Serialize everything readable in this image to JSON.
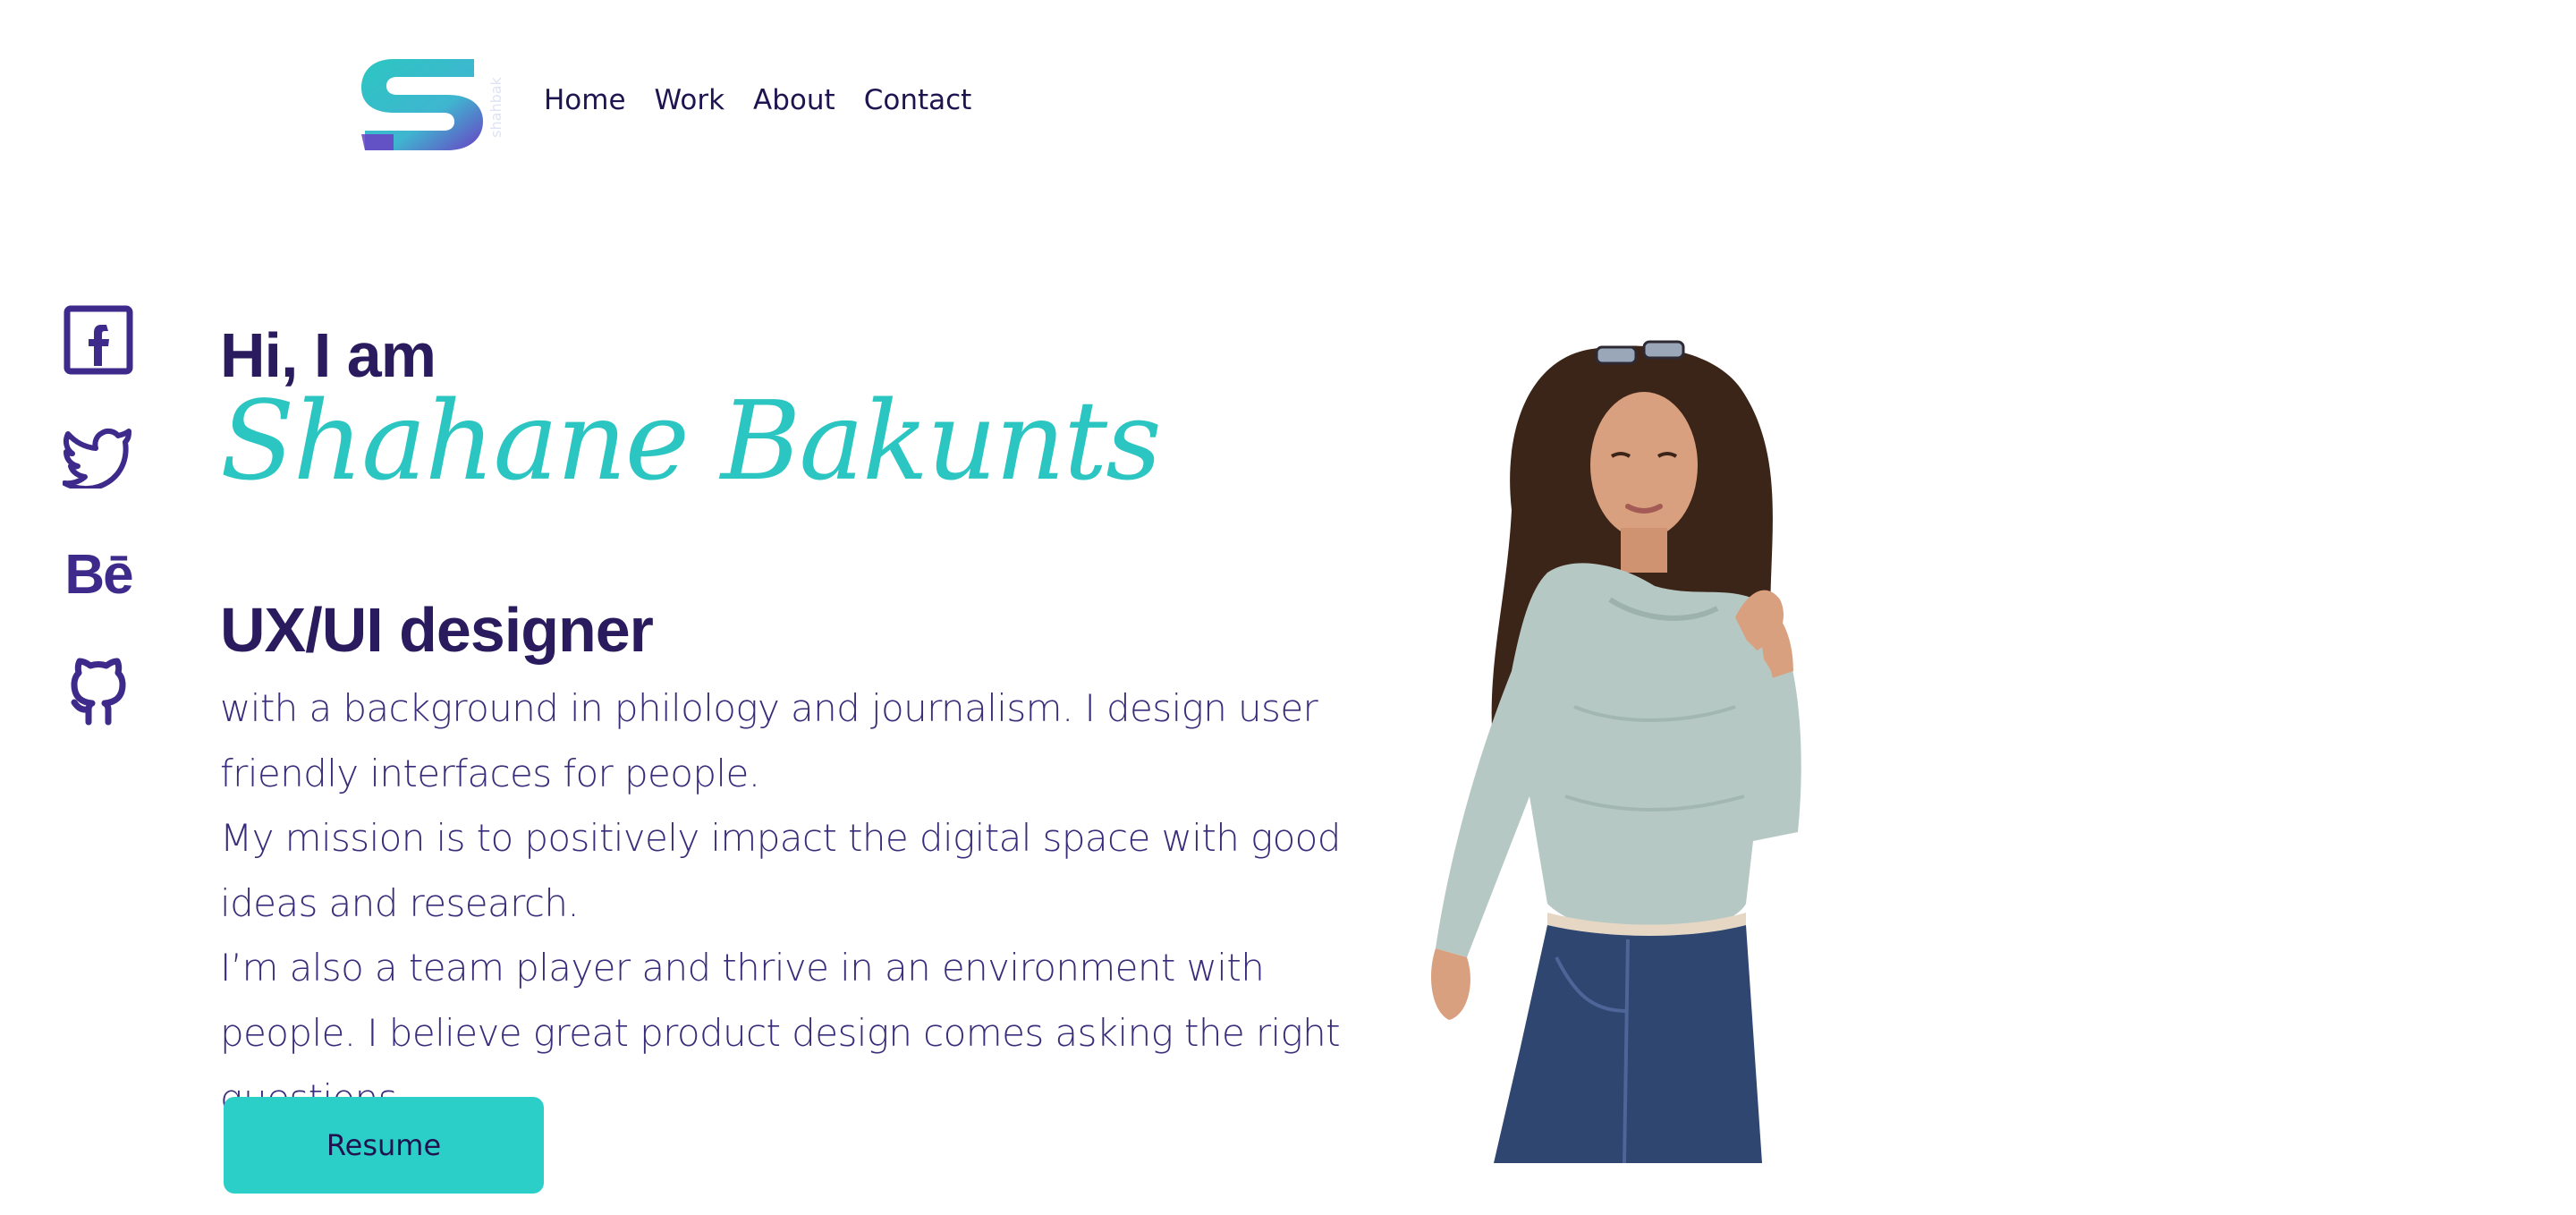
{
  "brand": {
    "logo_letter": "S",
    "logo_vertical_text": "shahbak",
    "gradient": [
      "#2bc6c1",
      "#6a3fc4"
    ]
  },
  "nav": {
    "items": [
      {
        "label": "Home"
      },
      {
        "label": "Work"
      },
      {
        "label": "About"
      },
      {
        "label": "Contact"
      }
    ]
  },
  "social": [
    {
      "icon": "facebook-icon"
    },
    {
      "icon": "twitter-icon"
    },
    {
      "icon": "behance-icon",
      "glyph": "Bē"
    },
    {
      "icon": "github-icon"
    }
  ],
  "hero": {
    "greeting": "Hi, I am",
    "name": "Shahane Bakunts",
    "role": "UX/UI designer",
    "bio": [
      "with a background in philology and journalism. I design user friendly interfaces for people.",
      "My mission is to positively impact the digital space with good ideas and research.",
      "I’m also a team player and thrive in an environment with people. I believe great product design comes asking the right questions."
    ],
    "resume_label": "Resume"
  },
  "colors": {
    "accent": "#2bc6c1",
    "primary": "#2a1a5e",
    "icon": "#3d2a8a"
  }
}
